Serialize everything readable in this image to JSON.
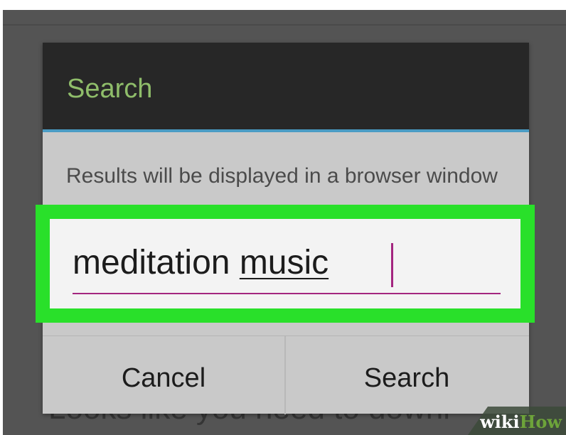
{
  "dialog": {
    "title": "Search",
    "message": "Results will be displayed in a browser window",
    "input_value_word1": "meditation",
    "input_value_word2": "music",
    "buttons": {
      "cancel": "Cancel",
      "search": "Search"
    }
  },
  "background": {
    "partial_text": "Looks like you need to downl"
  },
  "watermark": {
    "part1": "wiki",
    "part2": "How"
  },
  "colors": {
    "accent_title": "#8fbd6a",
    "header_rule": "#4a9cc4",
    "highlight_frame": "#29e02a",
    "caret": "#a3257f"
  },
  "icons": []
}
